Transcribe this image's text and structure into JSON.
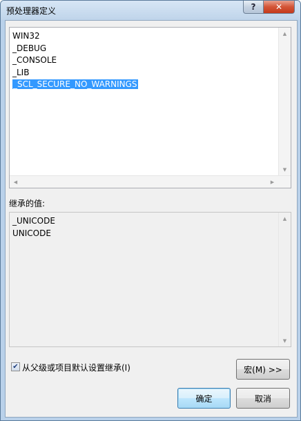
{
  "window": {
    "title": "预处理器定义",
    "help_label": "?",
    "close_label": "✕"
  },
  "definitions": {
    "items": [
      "WIN32",
      "_DEBUG",
      "_CONSOLE",
      "_LIB",
      "_SCL_SECURE_NO_WARNINGS"
    ],
    "selected_index": 4
  },
  "inherited": {
    "label": "继承的值:",
    "items": [
      "_UNICODE",
      "UNICODE"
    ]
  },
  "inherit_checkbox": {
    "checked": true,
    "label": "从父级或项目默认设置继承(I)"
  },
  "buttons": {
    "macros_label": "宏(M) >>",
    "ok_label": "确定",
    "cancel_label": "取消"
  },
  "icons": {
    "help": "question-mark-icon",
    "close": "close-x-icon",
    "scroll_up": "triangle-up-icon",
    "scroll_down": "triangle-down-icon",
    "scroll_left": "triangle-left-icon",
    "scroll_right": "triangle-right-icon",
    "check": "checkmark-icon"
  },
  "colors": {
    "selection": "#3399ff",
    "close_button": "#c43a1c",
    "default_button_border": "#3c7fb1"
  }
}
